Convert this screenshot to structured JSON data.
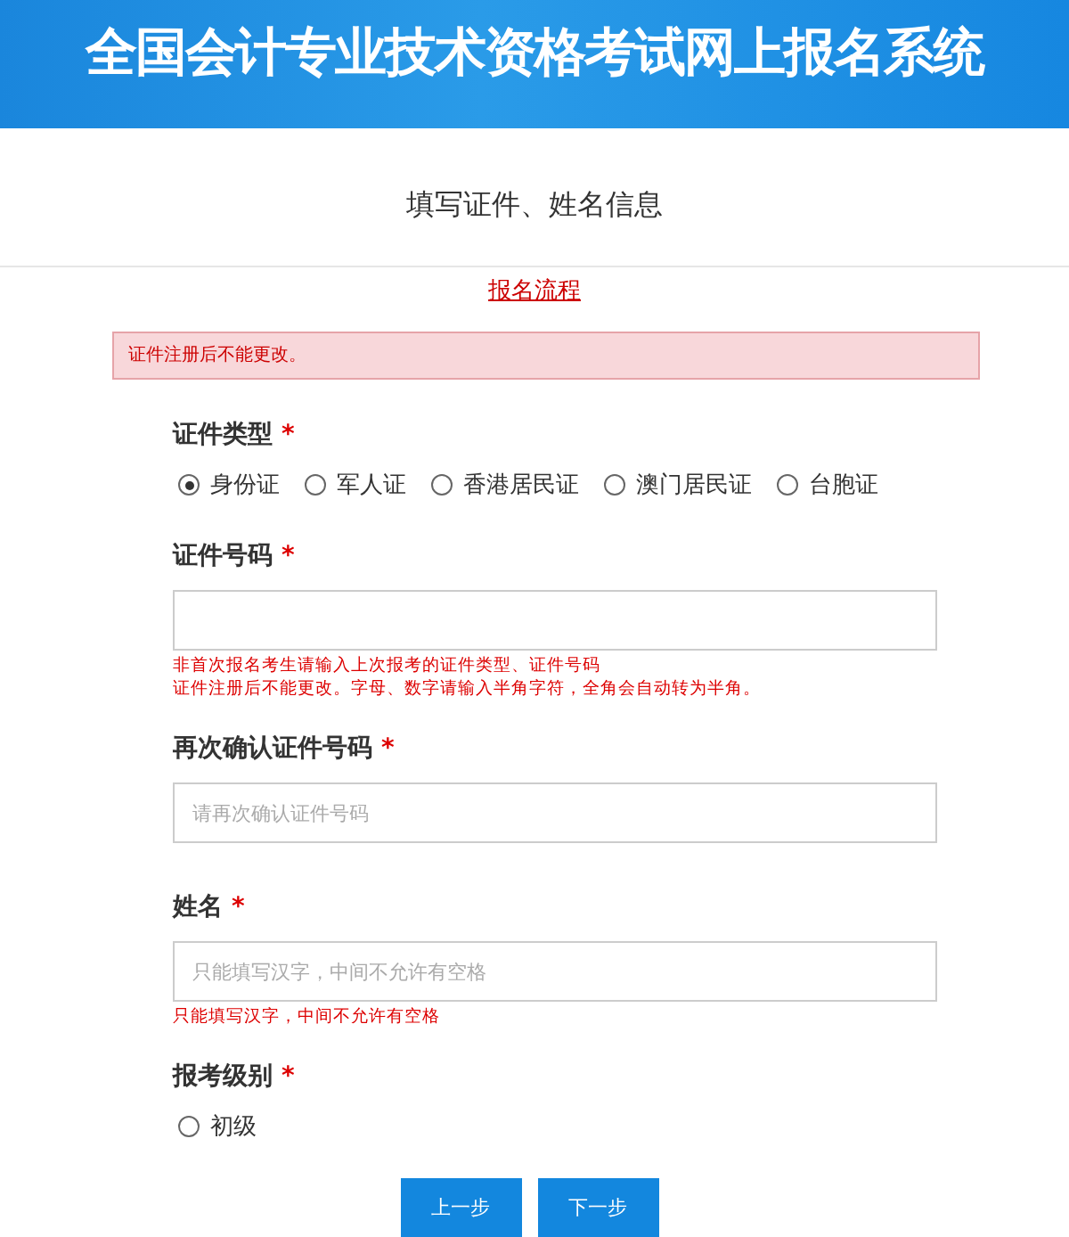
{
  "header": {
    "title": "全国会计专业技术资格考试网上报名系统"
  },
  "page_title": "填写证件、姓名信息",
  "process_link": "报名流程",
  "alert": "证件注册后不能更改。",
  "fields": [
    {
      "kind": "radio",
      "label": "证件类型",
      "mark": "*",
      "options": [
        {
          "label": "身份证",
          "selected": true
        },
        {
          "label": "军人证",
          "selected": false
        },
        {
          "label": "香港居民证",
          "selected": false
        },
        {
          "label": "澳门居民证",
          "selected": false
        },
        {
          "label": "台胞证",
          "selected": false
        }
      ]
    },
    {
      "kind": "text",
      "label": "证件号码",
      "mark": "*",
      "hints": [
        "非首次报名考生请输入上次报考的证件类型、证件号码",
        "证件注册后不能更改。字母、数字请输入半角字符，全角会自动转为半角。"
      ]
    },
    {
      "kind": "text",
      "label": "再次确认证件号码",
      "mark": "*",
      "placeholder": "请再次确认证件号码"
    },
    {
      "kind": "text",
      "label": "姓名",
      "mark": "*",
      "placeholder": "只能填写汉字，中间不允许有空格",
      "hints": [
        "只能填写汉字，中间不允许有空格"
      ]
    },
    {
      "kind": "radio",
      "label": "报考级别",
      "mark": "*",
      "options": [
        {
          "label": "初级",
          "selected": false
        }
      ]
    }
  ],
  "buttons": [
    {
      "label": "上一步"
    },
    {
      "label": "下一步"
    }
  ]
}
